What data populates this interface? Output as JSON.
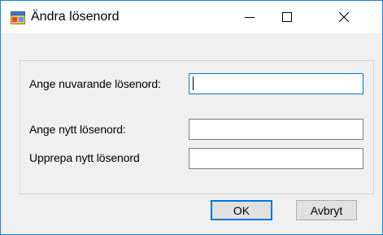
{
  "window": {
    "title": "Ändra lösenord",
    "icon": "app-form-icon",
    "controls": {
      "minimize": "minimize-icon",
      "maximize": "maximize-icon",
      "close": "close-icon"
    }
  },
  "form": {
    "current_password_label": "Ange nuvarande lösenord:",
    "current_password_value": "",
    "new_password_label": "Ange nytt lösenord:",
    "new_password_value": "",
    "repeat_password_label": "Upprepa nytt lösenord",
    "repeat_password_value": ""
  },
  "buttons": {
    "ok": "OK",
    "cancel": "Avbryt"
  },
  "colors": {
    "accent": "#0078d7",
    "window_border": "#1883d7",
    "background": "#f0f0f0"
  }
}
